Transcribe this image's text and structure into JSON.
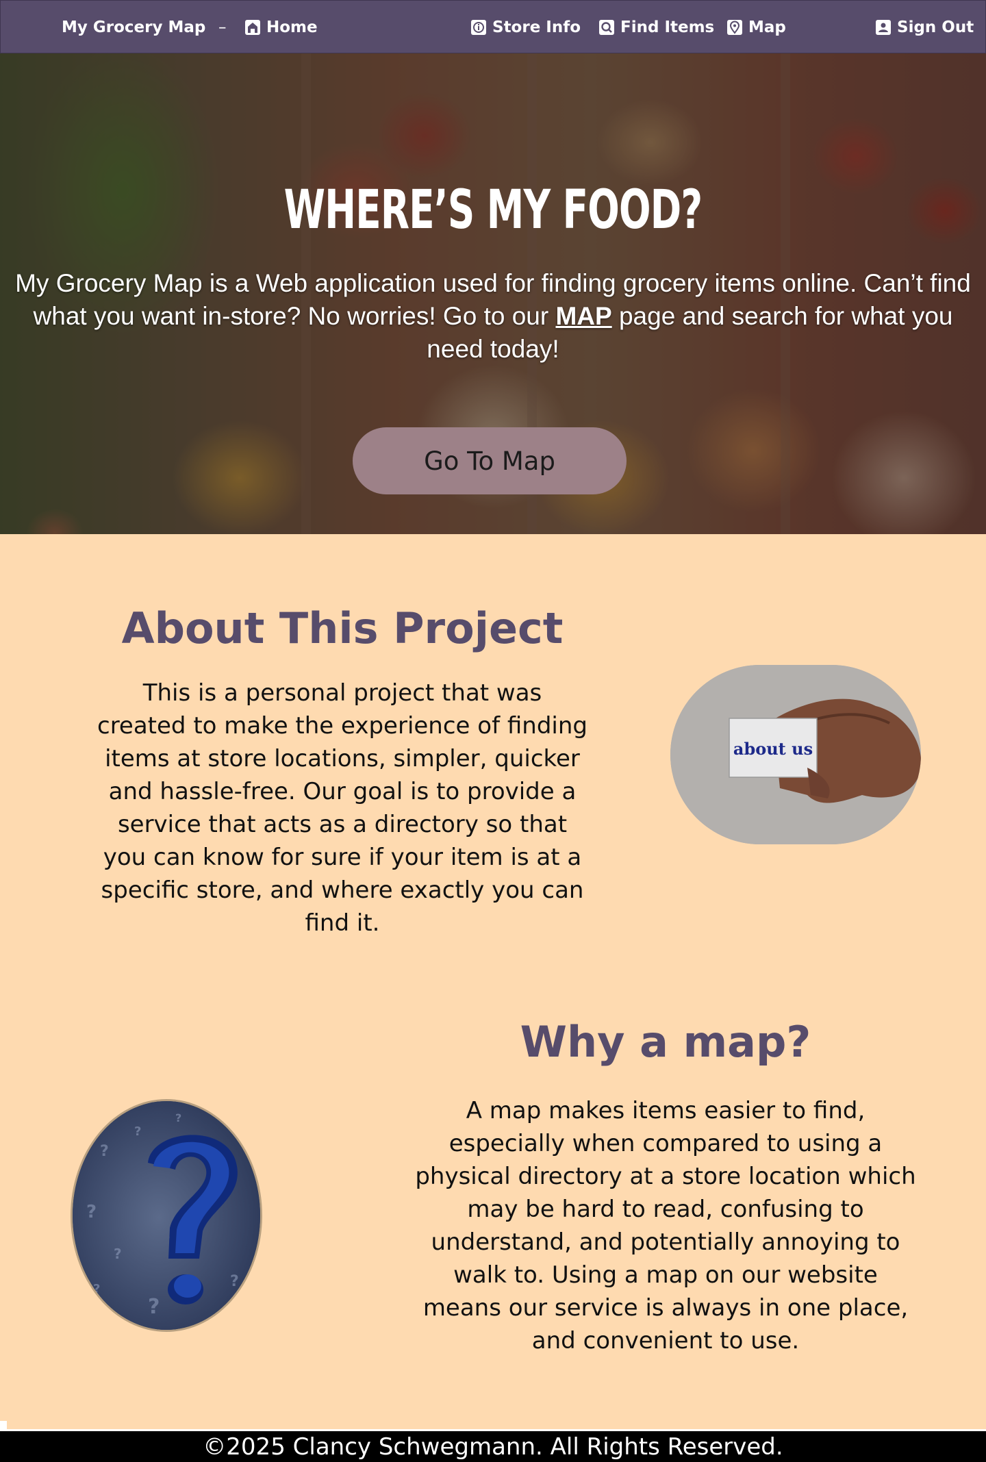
{
  "nav": {
    "brand": "My Grocery Map",
    "separator": "–",
    "home": "Home",
    "store_info": "Store Info",
    "find_items": "Find Items",
    "map": "Map",
    "sign_out": "Sign Out"
  },
  "hero": {
    "title": "WHERE’S MY FOOD?",
    "text_before": "My Grocery Map is a Web application used for finding grocery items online. Can’t find what you want in-store? No worries! Go to our ",
    "map_link": "MAP",
    "text_after": " page and search for what you need today!",
    "button": "Go To Map"
  },
  "about": {
    "title": "About This Project",
    "text": "This is a personal project that was created to make the experience of finding items at store locations, simpler, quicker and hassle-free. Our goal is to provide a service that acts as a directory so that you can know for sure if your item is at a specific store, and where exactly you can find it.",
    "image_card_text": "about us"
  },
  "why": {
    "title": "Why a map?",
    "text": "A map makes items easier to find, especially when compared to using a physical directory at a store location which may be hard to read, confusing to understand, and potentially annoying to walk to. Using a map on our website means our service is always in one place, and convenient to use."
  },
  "footer": {
    "copyright": "©2025 Clancy Schwegmann. All Rights Reserved."
  },
  "colors": {
    "nav_bg": "#574c6b",
    "page_bg": "#fedab0",
    "heading": "#574c6b",
    "button_bg": "#9d8188",
    "footer_bg": "#000000"
  }
}
